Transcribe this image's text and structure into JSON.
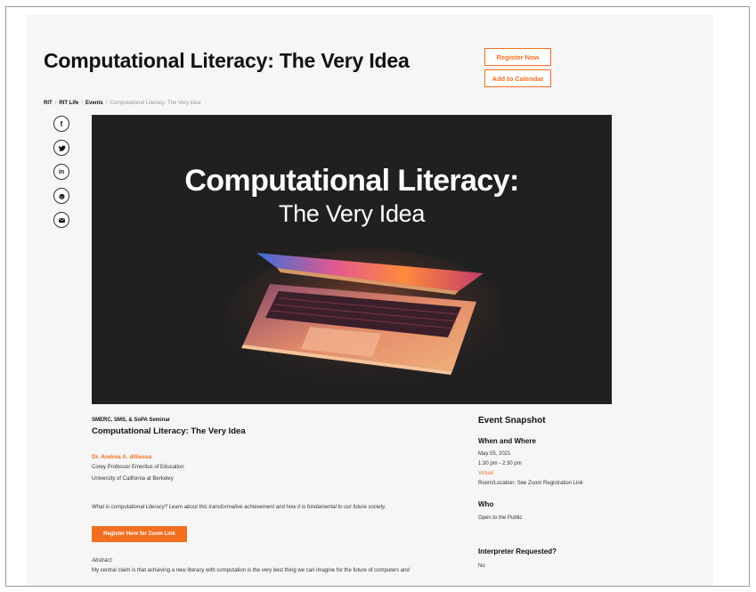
{
  "event": {
    "title": "Computational Literacy: The Very Idea",
    "register_label": "Register Now",
    "calendar_label": "Add to Calendar"
  },
  "breadcrumb": {
    "items": [
      "RIT",
      "RIT Life",
      "Events",
      "Computational Literacy: The Very Idea"
    ],
    "separator": "/"
  },
  "social": {
    "facebook": "f",
    "linkedin": "in"
  },
  "hero": {
    "line1": "Computational Literacy:",
    "line2": "The Very Idea"
  },
  "details": {
    "series": "SMERC, SMS, & SoPA Seminar",
    "title": "Computational Literacy: The Very Idea",
    "speaker_name": "Dr. Andrea A. diSessa",
    "speaker_role": "Corey Professor Emeritus of Education",
    "speaker_org": "University of California at Berkeley",
    "description": "What is computational Literacy? Learn about this transformative achievement and how it is fundamental to our future society.",
    "zoom_button": "Register Here for Zoom Link",
    "abstract_label": "Abstract:",
    "abstract_text": "My central claim is that achieving a new literacy with computation is the very best thing we can imagine for the future of computers and"
  },
  "snapshot": {
    "title": "Event Snapshot",
    "when_heading": "When and Where",
    "date": "May 05, 2021",
    "time": "1:30 pm - 2:30 pm",
    "mode": "Virtual",
    "location": "Room/Location: See Zoom Registration Link",
    "who_heading": "Who",
    "who_value": "Open to the Public",
    "interpreter_heading": "Interpreter Requested?",
    "interpreter_value": "No"
  },
  "colors": {
    "accent": "#f36e21",
    "hero_bg": "#202020"
  }
}
